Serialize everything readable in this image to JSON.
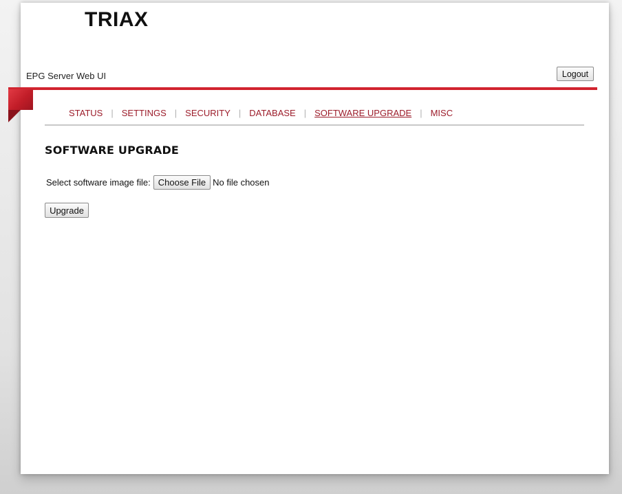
{
  "brand": {
    "logo_text": "TRIAX",
    "accent_color": "#d1242f",
    "link_color": "#9c1c2a"
  },
  "header": {
    "app_title": "EPG Server Web UI",
    "logout_label": "Logout"
  },
  "nav": {
    "items": [
      {
        "label": "STATUS",
        "active": false
      },
      {
        "label": "SETTINGS",
        "active": false
      },
      {
        "label": "SECURITY",
        "active": false
      },
      {
        "label": "DATABASE",
        "active": false
      },
      {
        "label": "SOFTWARE UPGRADE",
        "active": true
      },
      {
        "label": "MISC",
        "active": false
      }
    ],
    "separator": "|"
  },
  "main": {
    "heading": "SOFTWARE UPGRADE",
    "file_label": "Select software image file:",
    "choose_file_label": "Choose File",
    "file_status": "No file chosen",
    "upgrade_label": "Upgrade"
  }
}
